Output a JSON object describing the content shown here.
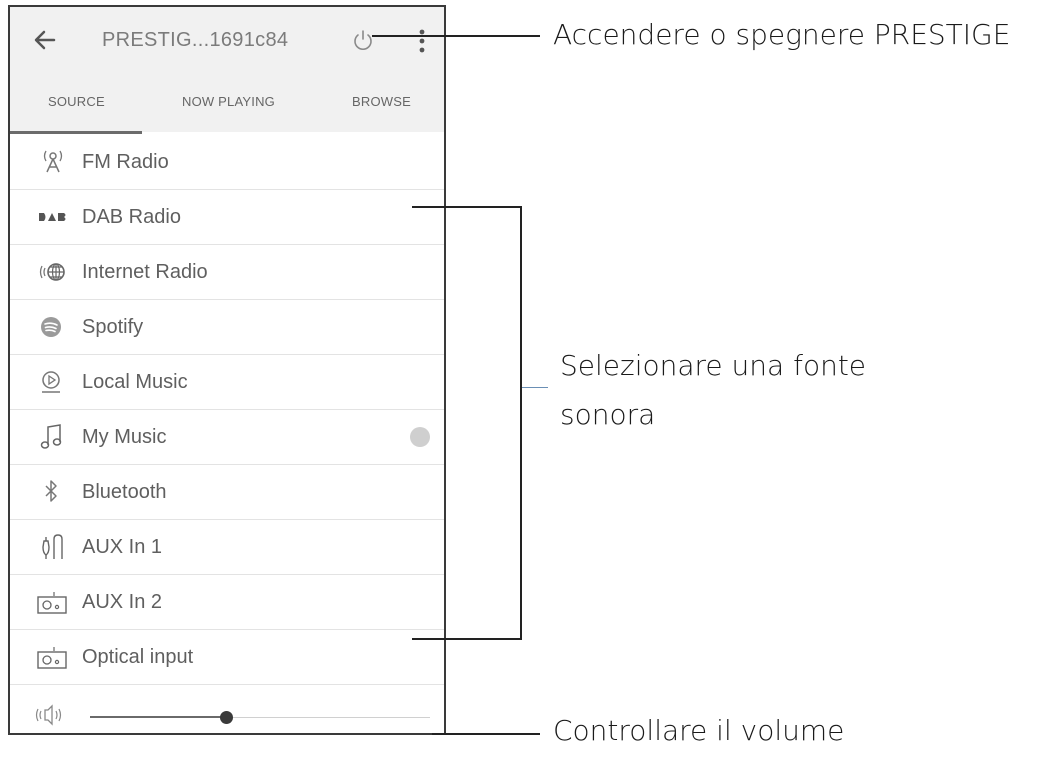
{
  "header": {
    "device_title": "PRESTIG...1691c84"
  },
  "tabs": [
    {
      "label": "SOURCE",
      "selected": true
    },
    {
      "label": "NOW PLAYING",
      "selected": false
    },
    {
      "label": "BROWSE",
      "selected": false
    }
  ],
  "sources": [
    {
      "label": "FM Radio",
      "icon": "fm-radio-icon"
    },
    {
      "label": "DAB Radio",
      "icon": "dab-icon"
    },
    {
      "label": "Internet Radio",
      "icon": "internet-radio-icon"
    },
    {
      "label": "Spotify",
      "icon": "spotify-icon"
    },
    {
      "label": "Local Music",
      "icon": "local-music-icon"
    },
    {
      "label": "My Music",
      "icon": "music-note-icon"
    },
    {
      "label": "Bluetooth",
      "icon": "bluetooth-icon"
    },
    {
      "label": "AUX In 1",
      "icon": "aux-cable-icon"
    },
    {
      "label": "AUX In 2",
      "icon": "aux-device-icon"
    },
    {
      "label": "Optical input",
      "icon": "optical-device-icon"
    }
  ],
  "volume": {
    "level": 0.4
  },
  "callouts": {
    "power": "Accendere o spegnere PRESTIGE",
    "source_line1": "Selezionare una fonte",
    "source_line2": "sonora",
    "volume": "Controllare il volume"
  },
  "colors": {
    "header_bg": "#f1f1f1",
    "text": "#5f5f5f",
    "divider": "#e3e3e3"
  }
}
